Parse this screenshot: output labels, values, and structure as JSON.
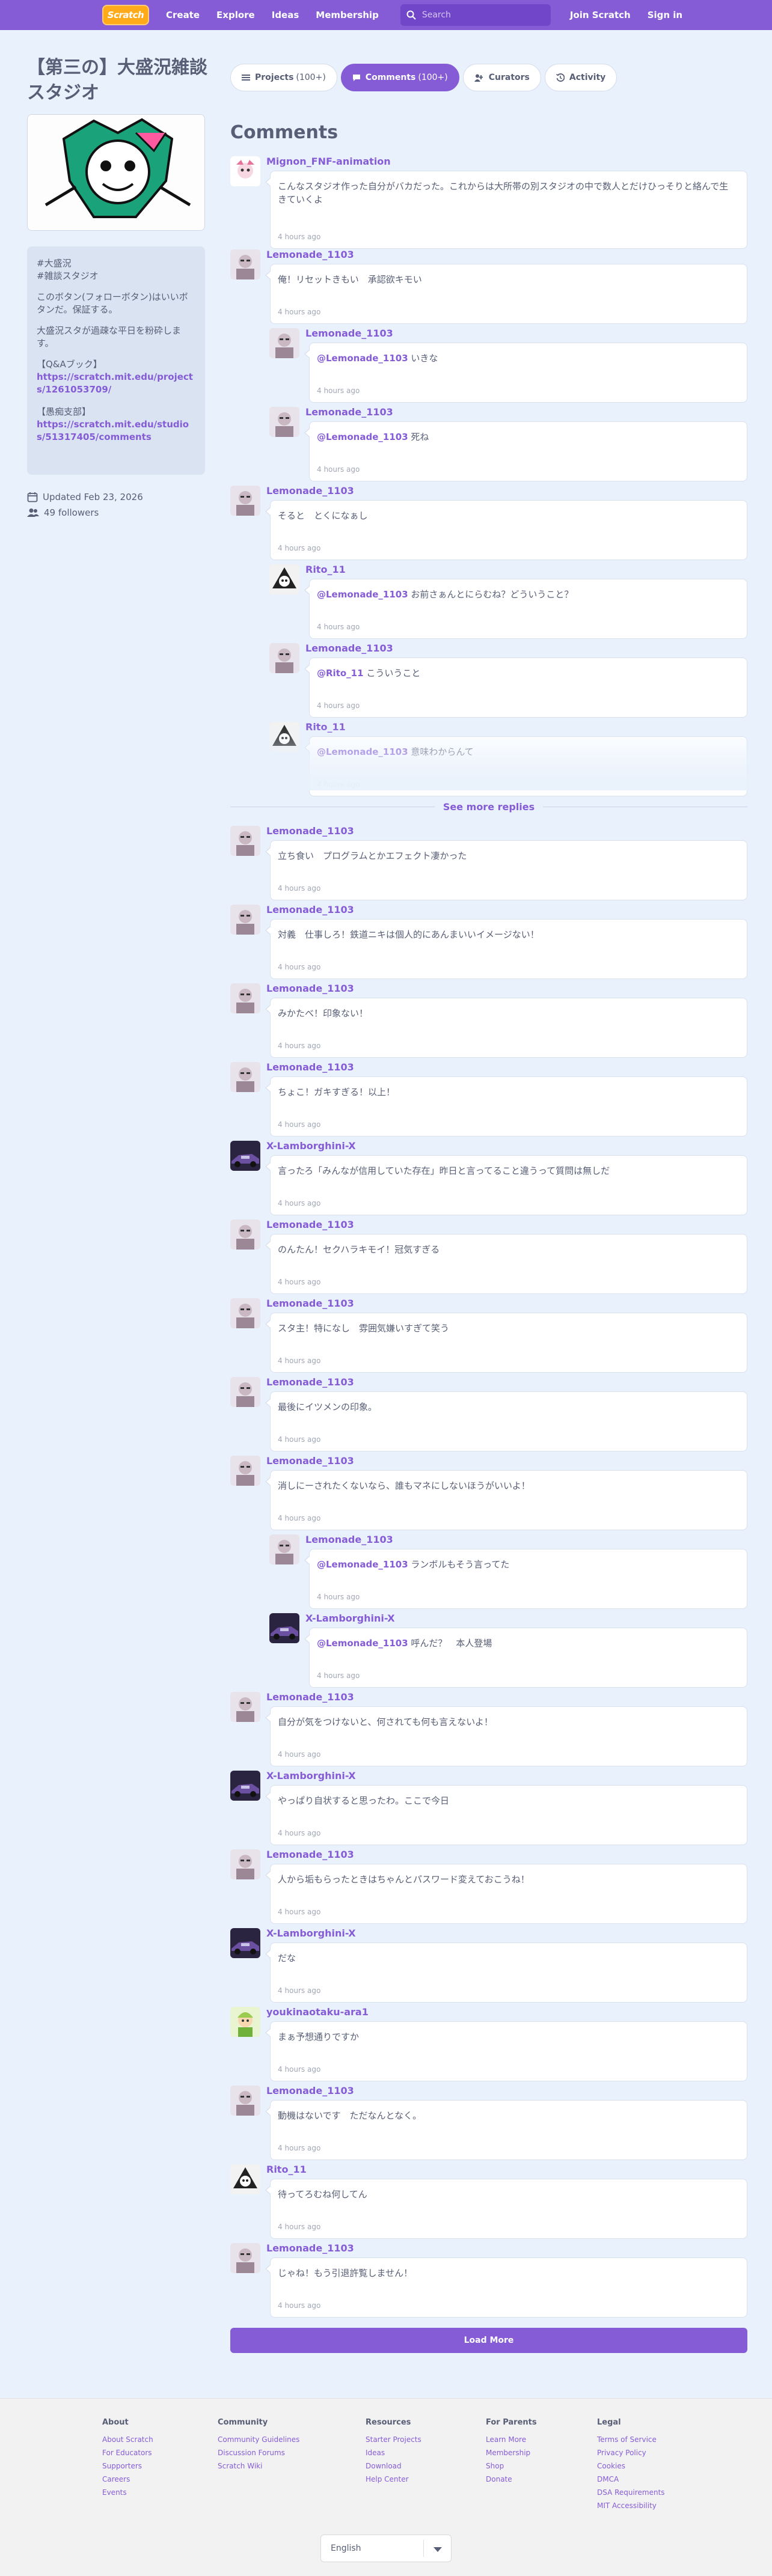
{
  "nav": {
    "logo": "Scratch",
    "create": "Create",
    "explore": "Explore",
    "ideas": "Ideas",
    "membership": "Membership",
    "search_placeholder": "Search",
    "join": "Join Scratch",
    "signin": "Sign in"
  },
  "studio": {
    "title": "【第三の】大盛況雑談スタジオ",
    "description": [
      "#大盛況\n#雑談スタジオ",
      "このボタン(フォローボタン)はいいボタンだ。保証する。",
      "大盛況スタが過疎な平日を粉砕します。"
    ],
    "link1_label": "【Q&Aブック】",
    "link1_url": "https://scratch.mit.edu/projects/1261053709/",
    "link2_label": "【愚痴支部】",
    "link2_url": "https://scratch.mit.edu/studios/51317405/comments",
    "updated": "Updated Feb 23, 2026",
    "followers": "49 followers"
  },
  "tabs": {
    "projects": "Projects",
    "projects_count": "(100+)",
    "comments": "Comments",
    "comments_count": "(100+)",
    "curators": "Curators",
    "activity": "Activity"
  },
  "section_title": "Comments",
  "comments": [
    {
      "user": "Mignon_FNF-animation",
      "text1": "こんなスタジオ作った自分がバカだった。これからは大所帯の別スタジオの中で数人とだけひっそりと絡んで生きていくよ",
      "text2": "で生きていくよ",
      "time": "4 hours ago"
    },
    {
      "user": "Lemonade_1103",
      "text": "俺！リセットきもい　承認欲キモい",
      "time": "4 hours ago"
    },
    {
      "user": "Lemonade_1103",
      "mention": "@Lemonade_1103",
      "text": " いきな",
      "time": "4 hours ago"
    },
    {
      "user": "Lemonade_1103",
      "mention": "@Lemonade_1103",
      "text": " 死ね",
      "time": "4 hours ago"
    },
    {
      "user": "Lemonade_1103",
      "text": "そると　とくになぁし",
      "time": "4 hours ago"
    },
    {
      "user": "Rito_11",
      "mention": "@Lemonade_1103",
      "text": " お前さぁんとにらむね？どういうこと？",
      "time": "4 hours ago"
    },
    {
      "user": "Lemonade_1103",
      "mention": "@Rito_11",
      "text": " こういうこと",
      "time": "4 hours ago"
    },
    {
      "user": "Rito_11",
      "mention": "@Lemonade_1103",
      "text": " 意味わからんて",
      "time": "4 hours ago"
    },
    {
      "user": "Lemonade_1103",
      "text": "立ち食い　プログラムとかエフェクト凄かった",
      "time": "4 hours ago"
    },
    {
      "user": "Lemonade_1103",
      "text": "対義　仕事しろ！鉄道ニキは個人的にあんまいいイメージない！",
      "time": "4 hours ago"
    },
    {
      "user": "Lemonade_1103",
      "text": "みかたべ！印象ない！",
      "time": "4 hours ago"
    },
    {
      "user": "Lemonade_1103",
      "text": "ちょこ！ガキすぎる！以上！",
      "time": "4 hours ago"
    },
    {
      "user": "X-Lamborghini-X",
      "text": "言ったろ「みんなが信用していた存在」昨日と言ってること違うって質問は無しだ",
      "time": "4 hours ago"
    },
    {
      "user": "Lemonade_1103",
      "text": "のんたん！セクハラキモイ！冠気すぎる",
      "time": "4 hours ago"
    },
    {
      "user": "Lemonade_1103",
      "text": "スタ主！特になし　雰囲気嫌いすぎて笑う",
      "time": "4 hours ago"
    },
    {
      "user": "Lemonade_1103",
      "text": "最後にイツメンの印象。",
      "time": "4 hours ago"
    },
    {
      "user": "Lemonade_1103",
      "text": "消しにーされたくないなら、誰もマネにしないほうがいいよ！",
      "time": "4 hours ago"
    },
    {
      "user": "Lemonade_1103",
      "mention": "@Lemonade_1103",
      "text": " ランボルもそう言ってた",
      "time": "4 hours ago"
    },
    {
      "user": "X-Lamborghini-X",
      "mention": "@Lemonade_1103",
      "text": " 呼んだ？　本人登場",
      "time": "4 hours ago"
    },
    {
      "user": "Lemonade_1103",
      "text": "自分が気をつけないと、何されても何も言えないよ！",
      "time": "4 hours ago"
    },
    {
      "user": "X-Lamborghini-X",
      "text": "やっぱり自状すると思ったわ。ここで今日",
      "time": "4 hours ago"
    },
    {
      "user": "Lemonade_1103",
      "text": "人から垢もらったときはちゃんとパスワード変えておこうね！",
      "time": "4 hours ago"
    },
    {
      "user": "X-Lamborghini-X",
      "text": "だな",
      "time": "4 hours ago"
    },
    {
      "user": "youkinaotaku-ara1",
      "text": "まぁ予想通りですか",
      "time": "4 hours ago"
    },
    {
      "user": "Lemonade_1103",
      "text": "動機はないです　ただなんとなく。",
      "time": "4 hours ago"
    },
    {
      "user": "Rito_11",
      "text": "待ってろむね何してん",
      "time": "4 hours ago"
    },
    {
      "user": "Lemonade_1103",
      "text": "じゃね！もう引退許覧しません！",
      "time": "4 hours ago"
    }
  ],
  "see_more_replies": "See more replies",
  "load_more": "Load More",
  "footer": {
    "about": {
      "title": "About",
      "items": [
        "About Scratch",
        "For Educators",
        "Supporters",
        "Careers",
        "Events"
      ]
    },
    "community": {
      "title": "Community",
      "items": [
        "Community Guidelines",
        "Discussion Forums",
        "Scratch Wiki"
      ]
    },
    "resources": {
      "title": "Resources",
      "items": [
        "Starter Projects",
        "Ideas",
        "Download",
        "Help Center"
      ]
    },
    "parents": {
      "title": "For Parents",
      "items": [
        "Learn More",
        "Membership",
        "Shop",
        "Donate"
      ]
    },
    "legal": {
      "title": "Legal",
      "items": [
        "Terms of Service",
        "Privacy Policy",
        "Cookies",
        "DMCA",
        "DSA Requirements",
        "MIT Accessibility"
      ]
    },
    "language": "English"
  },
  "colors": {
    "brand": "#855cd6",
    "background": "#e9f1fc",
    "logo": "#ffab19"
  }
}
